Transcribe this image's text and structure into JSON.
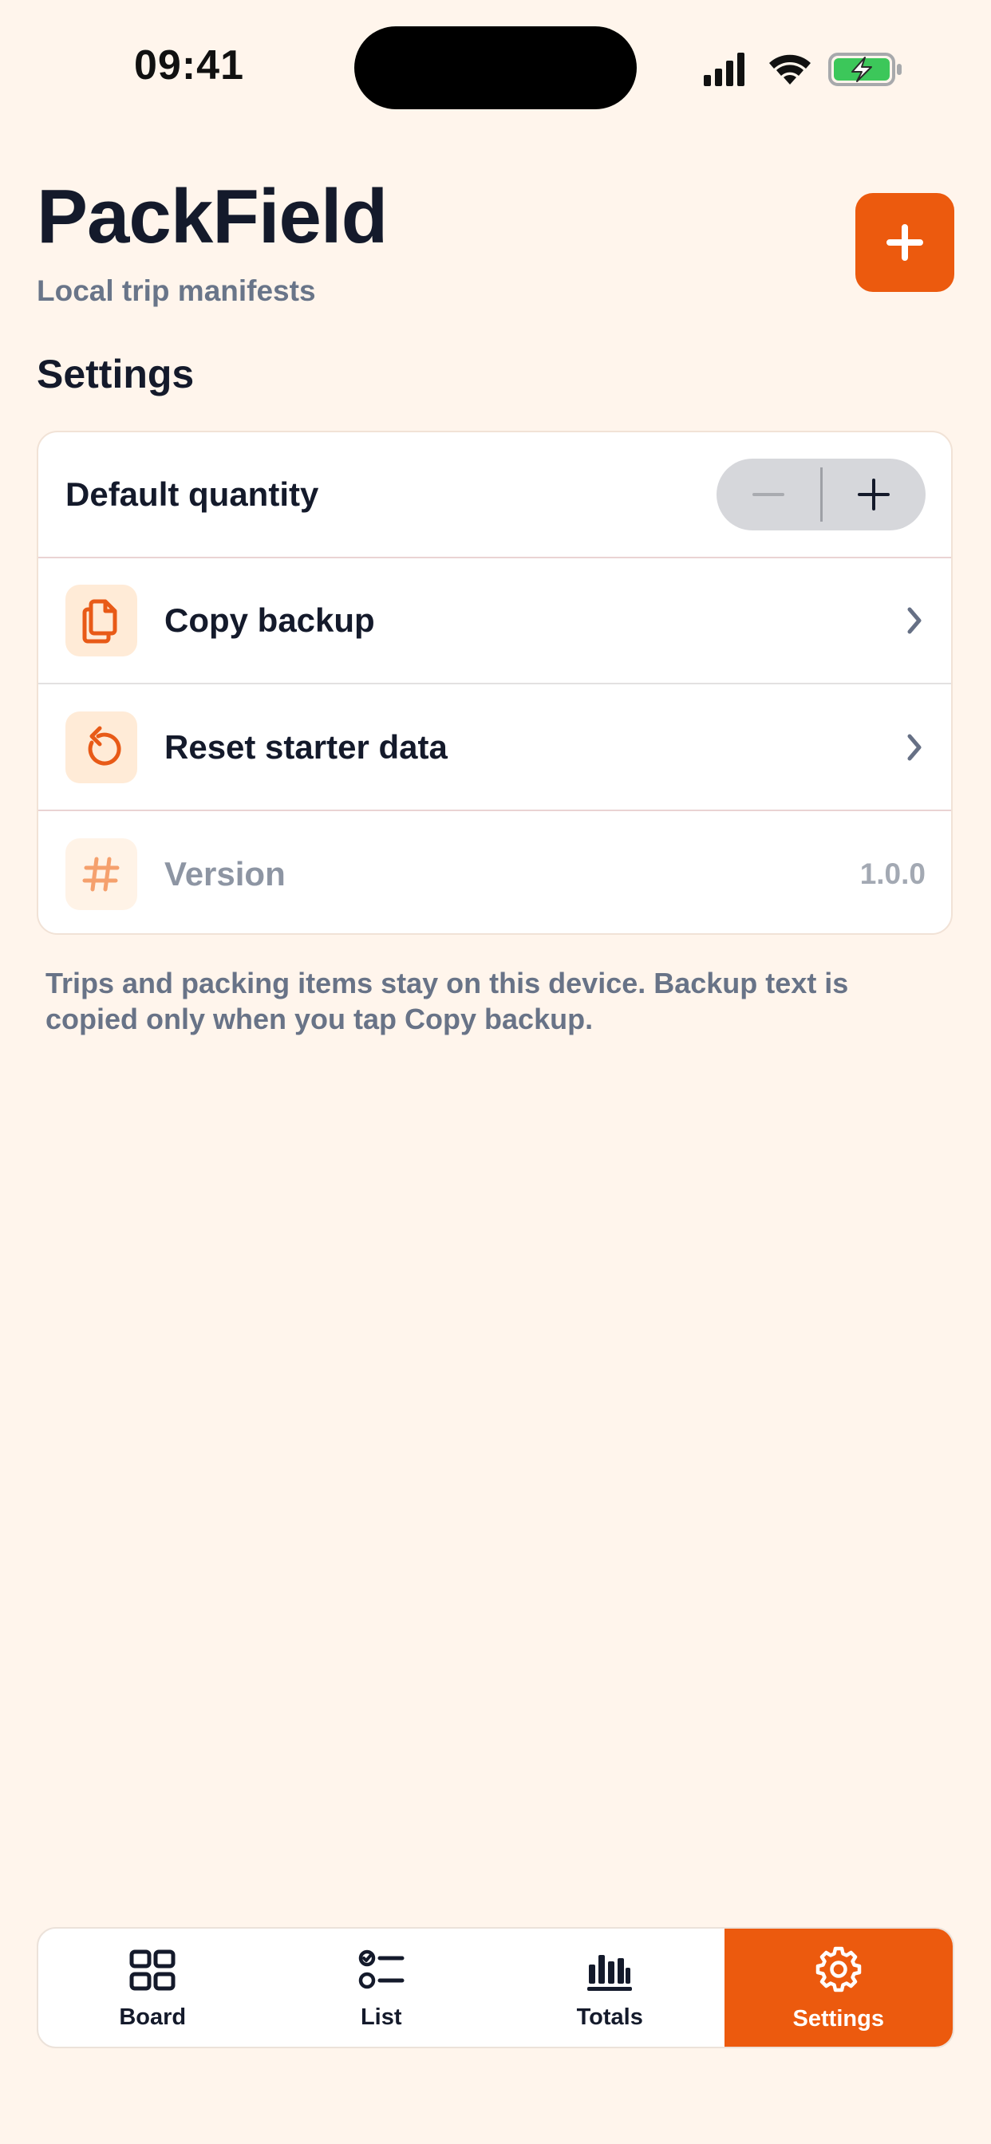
{
  "status_bar": {
    "time": "09:41"
  },
  "header": {
    "title": "PackField",
    "subtitle": "Local trip manifests",
    "add_icon": "plus-icon"
  },
  "settings": {
    "section_title": "Settings",
    "rows": [
      {
        "label": "Default quantity",
        "control": "stepper"
      },
      {
        "label": "Copy backup",
        "icon": "copy-document-icon"
      },
      {
        "label": "Reset starter data",
        "icon": "reset-arrow-icon"
      },
      {
        "label": "Version",
        "icon": "hash-icon",
        "value": "1.0.0"
      }
    ],
    "footnote": "Trips and packing items stay on this device. Backup text is copied only when you tap Copy backup."
  },
  "tab_bar": {
    "tabs": [
      {
        "label": "Board",
        "icon": "grid-icon"
      },
      {
        "label": "List",
        "icon": "checklist-icon"
      },
      {
        "label": "Totals",
        "icon": "bar-chart-icon"
      },
      {
        "label": "Settings",
        "icon": "gear-icon",
        "active": true
      }
    ]
  },
  "colors": {
    "background": "#FFF5EC",
    "accent": "#EC5A0E",
    "text": "#141A2B",
    "muted": "#697589"
  }
}
